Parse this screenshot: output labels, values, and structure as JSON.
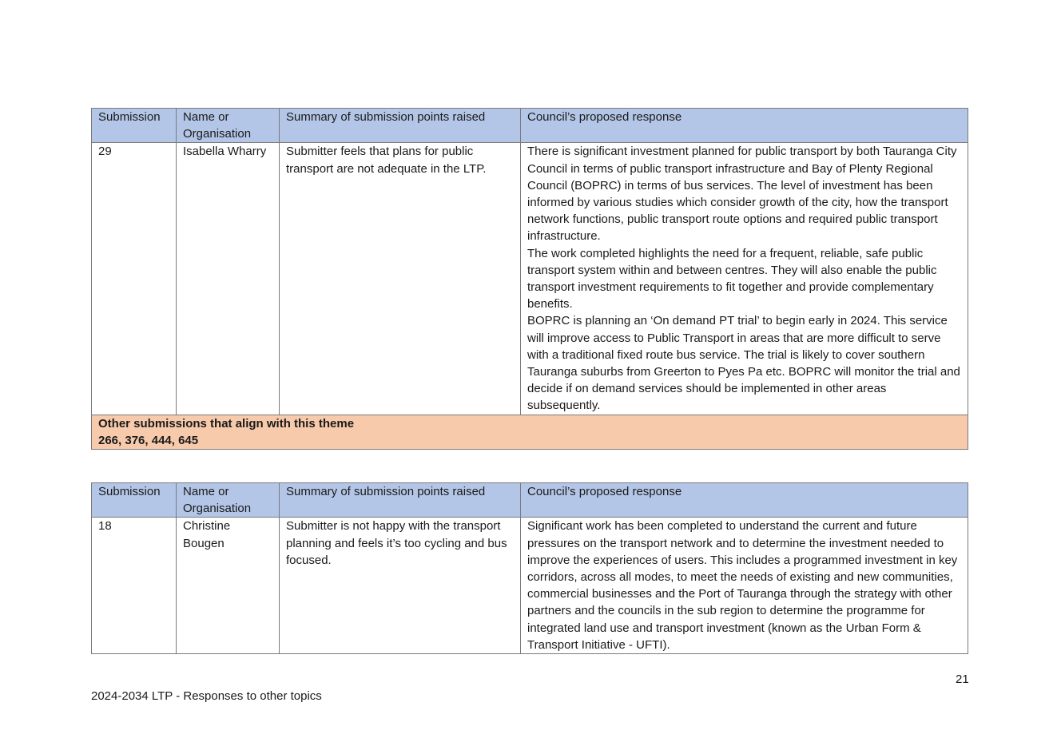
{
  "tables": [
    {
      "headers": [
        "Submission",
        "Name or Organisation",
        "Summary of submission points raised",
        "Council’s proposed response"
      ],
      "row": {
        "submission": "29",
        "name": "Isabella Wharry",
        "summary": "Submitter feels that plans for public transport are not adequate in the LTP.",
        "response": [
          "There is significant investment planned for public transport by both Tauranga City Council in terms of public transport infrastructure and Bay of Plenty Regional Council (BOPRC) in terms of bus services. The level of investment has been informed by various studies which consider growth of the city, how the transport network functions, public transport route options and required public transport infrastructure.",
          "The work completed highlights the need for a frequent, reliable, safe public transport system within and between centres.  They will also enable the public transport investment requirements to fit together and provide complementary benefits.",
          "BOPRC is planning an ‘On demand PT trial’ to begin early in 2024. This service will improve access to Public Transport in areas that are more difficult to serve with a traditional fixed route bus service. The trial is likely to cover southern Tauranga suburbs from Greerton to Pyes Pa etc. BOPRC will monitor the trial and decide if on demand services should be implemented in other areas subsequently."
        ]
      },
      "align": {
        "title": "Other submissions that align with this theme",
        "ids": "266, 376, 444, 645"
      }
    },
    {
      "headers": [
        "Submission",
        "Name or Organisation",
        "Summary of submission points raised",
        "Council’s proposed response"
      ],
      "row": {
        "submission": "18",
        "name": "Christine Bougen",
        "summary": "Submitter is not happy with the transport planning and feels it’s too cycling and bus focused.",
        "response": [
          "Significant work has been completed to understand the current and future pressures on the transport network and to determine the investment needed to improve the experiences of users. This includes a programmed investment in key corridors, across all modes, to meet the needs of existing and new communities, commercial businesses and the Port of Tauranga through the strategy with other partners and the councils in the sub region to determine the programme for integrated land use and transport investment (known as the Urban Form & Transport Initiative - UFTI)."
        ]
      }
    }
  ],
  "page_number": "21",
  "footer": "2024-2034 LTP - Responses to other topics"
}
